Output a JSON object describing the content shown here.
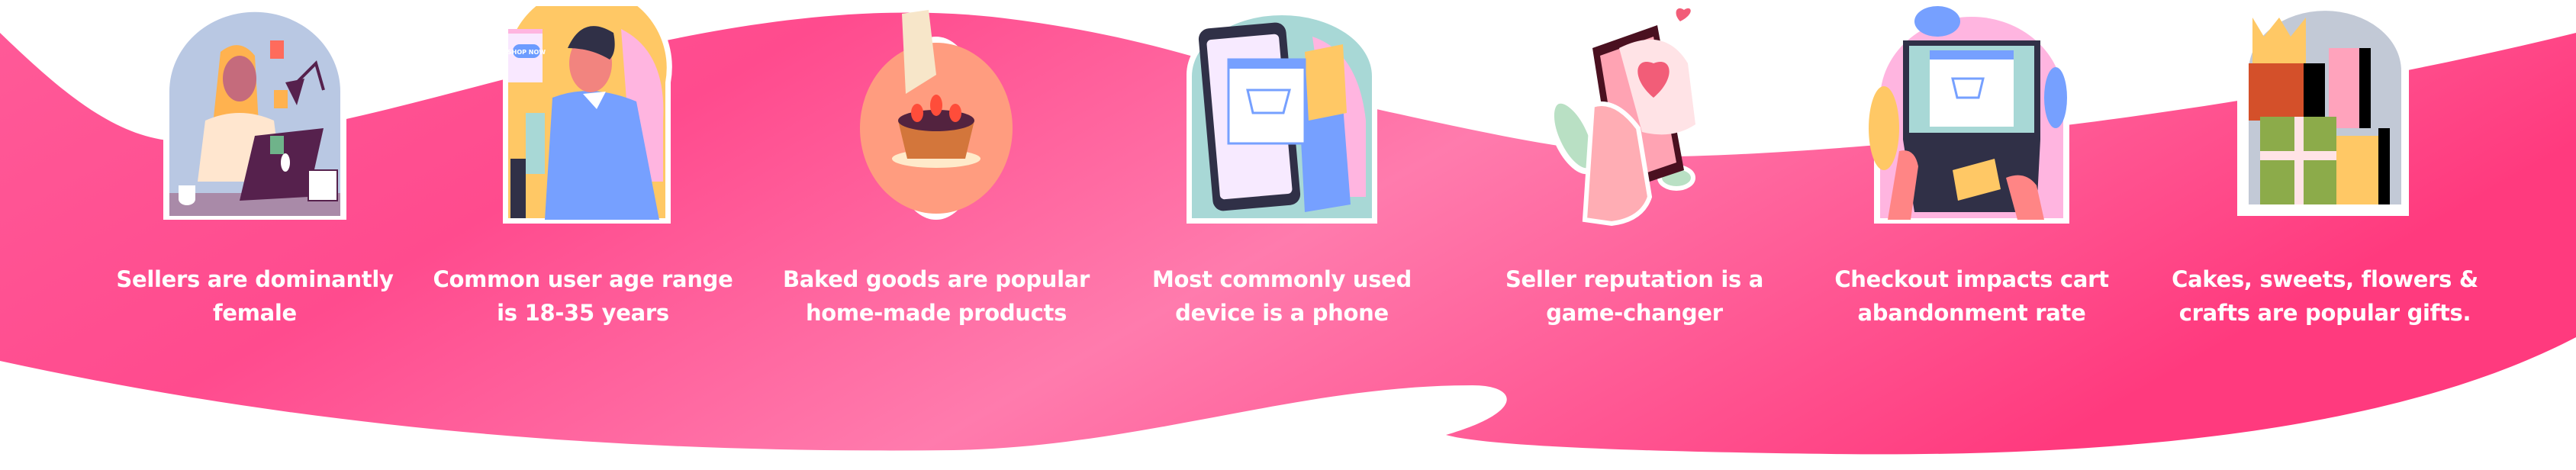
{
  "colors": {
    "band_start": "#ff5a98",
    "band_mid": "#ff78ab",
    "band_end": "#ff3d80",
    "text": "#ffffff"
  },
  "features": [
    {
      "icon": "seller-woman-laptop-icon",
      "line1": "Sellers are dominantly",
      "line2": "female"
    },
    {
      "icon": "man-shop-now-icon",
      "line1": "Common user age range",
      "line2": "is 18-35 years",
      "badge": "SHOP NOW"
    },
    {
      "icon": "strawberry-tart-icon",
      "line1": "Baked goods are popular",
      "line2": "home-made products"
    },
    {
      "icon": "tablet-shopping-cart-icon",
      "line1": "Most commonly used",
      "line2": "device is a phone"
    },
    {
      "icon": "phone-heart-icon",
      "line1": "Seller reputation is a",
      "line2": "game-changer"
    },
    {
      "icon": "laptop-credit-card-icon",
      "line1": "Checkout impacts cart",
      "line2": "abandonment rate"
    },
    {
      "icon": "gift-boxes-crown-icon",
      "line1": "Cakes, sweets,  flowers &",
      "line2": "crafts are popular gifts."
    }
  ]
}
